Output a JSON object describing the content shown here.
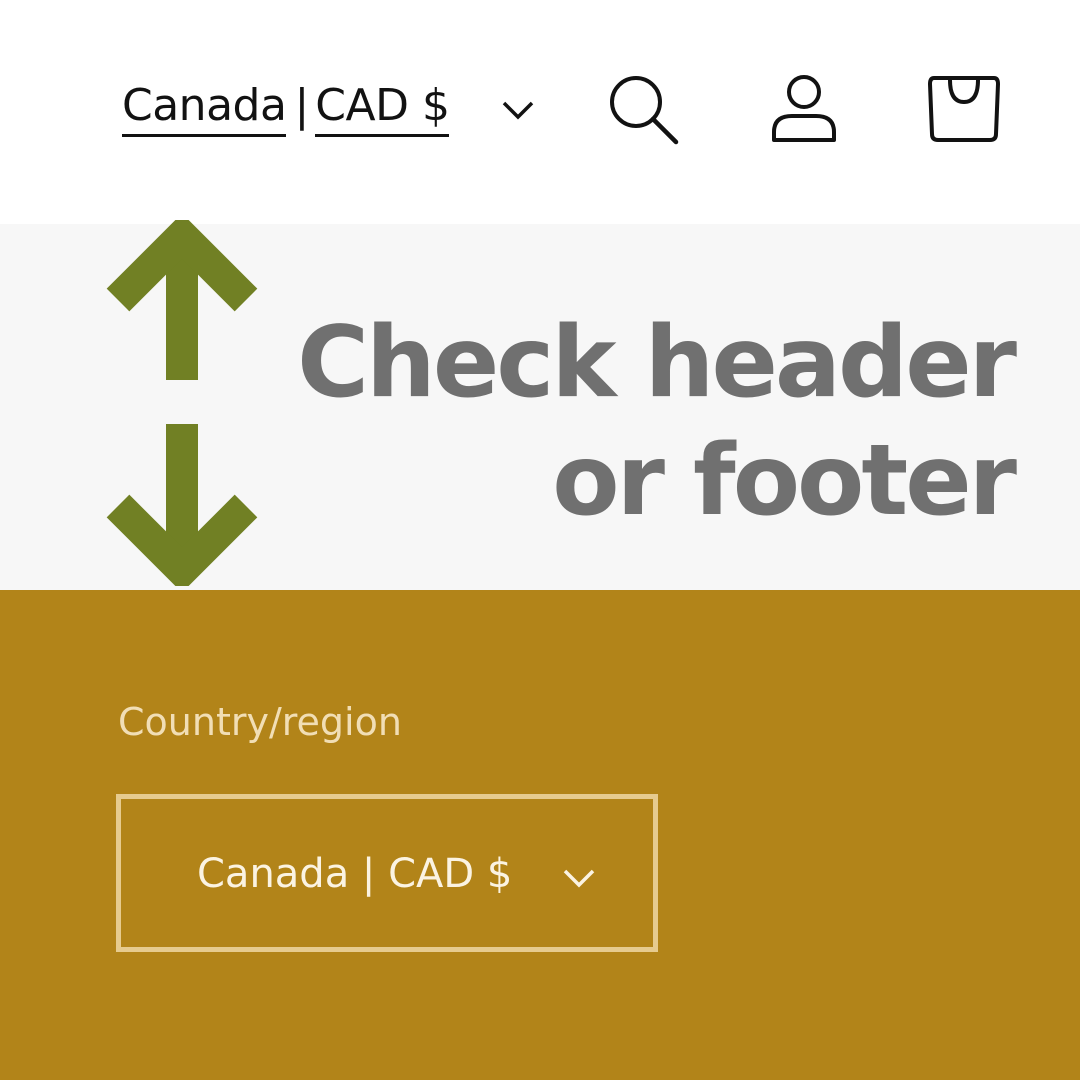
{
  "header": {
    "locale": {
      "country": "Canada",
      "separator": "|",
      "currency": "CAD $",
      "chevron_icon": "chevron-down-icon"
    },
    "icons": [
      "search-icon",
      "account-icon",
      "cart-icon"
    ]
  },
  "banner": {
    "line1": "Check header",
    "line2": "or footer",
    "arrow_color": "#718024",
    "text_color": "#707070",
    "background": "#f7f7f7",
    "icons": [
      "arrow-up-icon",
      "arrow-down-icon"
    ]
  },
  "footer": {
    "background": "#b28419",
    "label": "Country/region",
    "select_value": "Canada | CAD $",
    "chevron_icon": "chevron-down-icon"
  }
}
